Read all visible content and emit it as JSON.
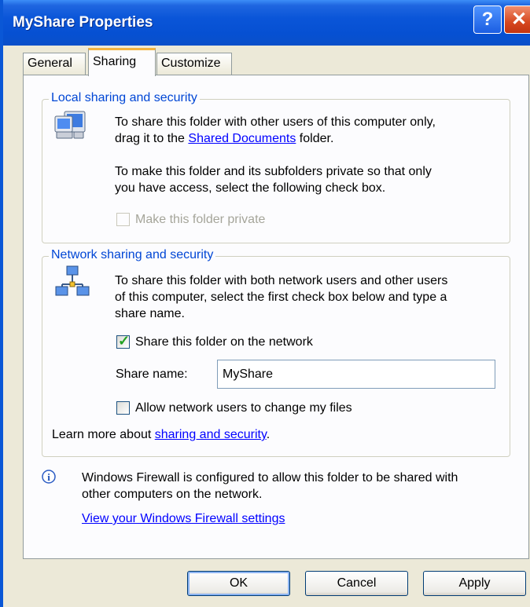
{
  "window": {
    "title": "MyShare Properties"
  },
  "tabs": [
    {
      "label": "General"
    },
    {
      "label": "Sharing"
    },
    {
      "label": "Customize"
    }
  ],
  "local": {
    "legend": "Local sharing and security",
    "line1": "To share this folder with other users of this computer only,",
    "line2_prefix": "drag it to the ",
    "line2_link": "Shared Documents",
    "line2_suffix": " folder.",
    "private_line1": "To make this folder and its subfolders private so that only",
    "private_line2": "you have access, select the following check box.",
    "private_checkbox": "Make this folder private"
  },
  "network": {
    "legend": "Network sharing and security",
    "line1": "To share this folder with both network users and other users",
    "line2": "of this computer, select the first check box below and type a",
    "line3": "share name.",
    "share_checkbox": "Share this folder on the network",
    "share_name_label": "Share name:",
    "share_name_value": "MyShare",
    "change_checkbox": "Allow network users to change my files",
    "learn_prefix": "Learn more about ",
    "learn_link": "sharing and security",
    "learn_suffix": "."
  },
  "firewall": {
    "line1": "Windows Firewall is configured to allow this folder to be shared with",
    "line2": "other computers on the network.",
    "link": "View your Windows Firewall settings"
  },
  "buttons": {
    "ok": "OK",
    "cancel": "Cancel",
    "apply": "Apply"
  }
}
